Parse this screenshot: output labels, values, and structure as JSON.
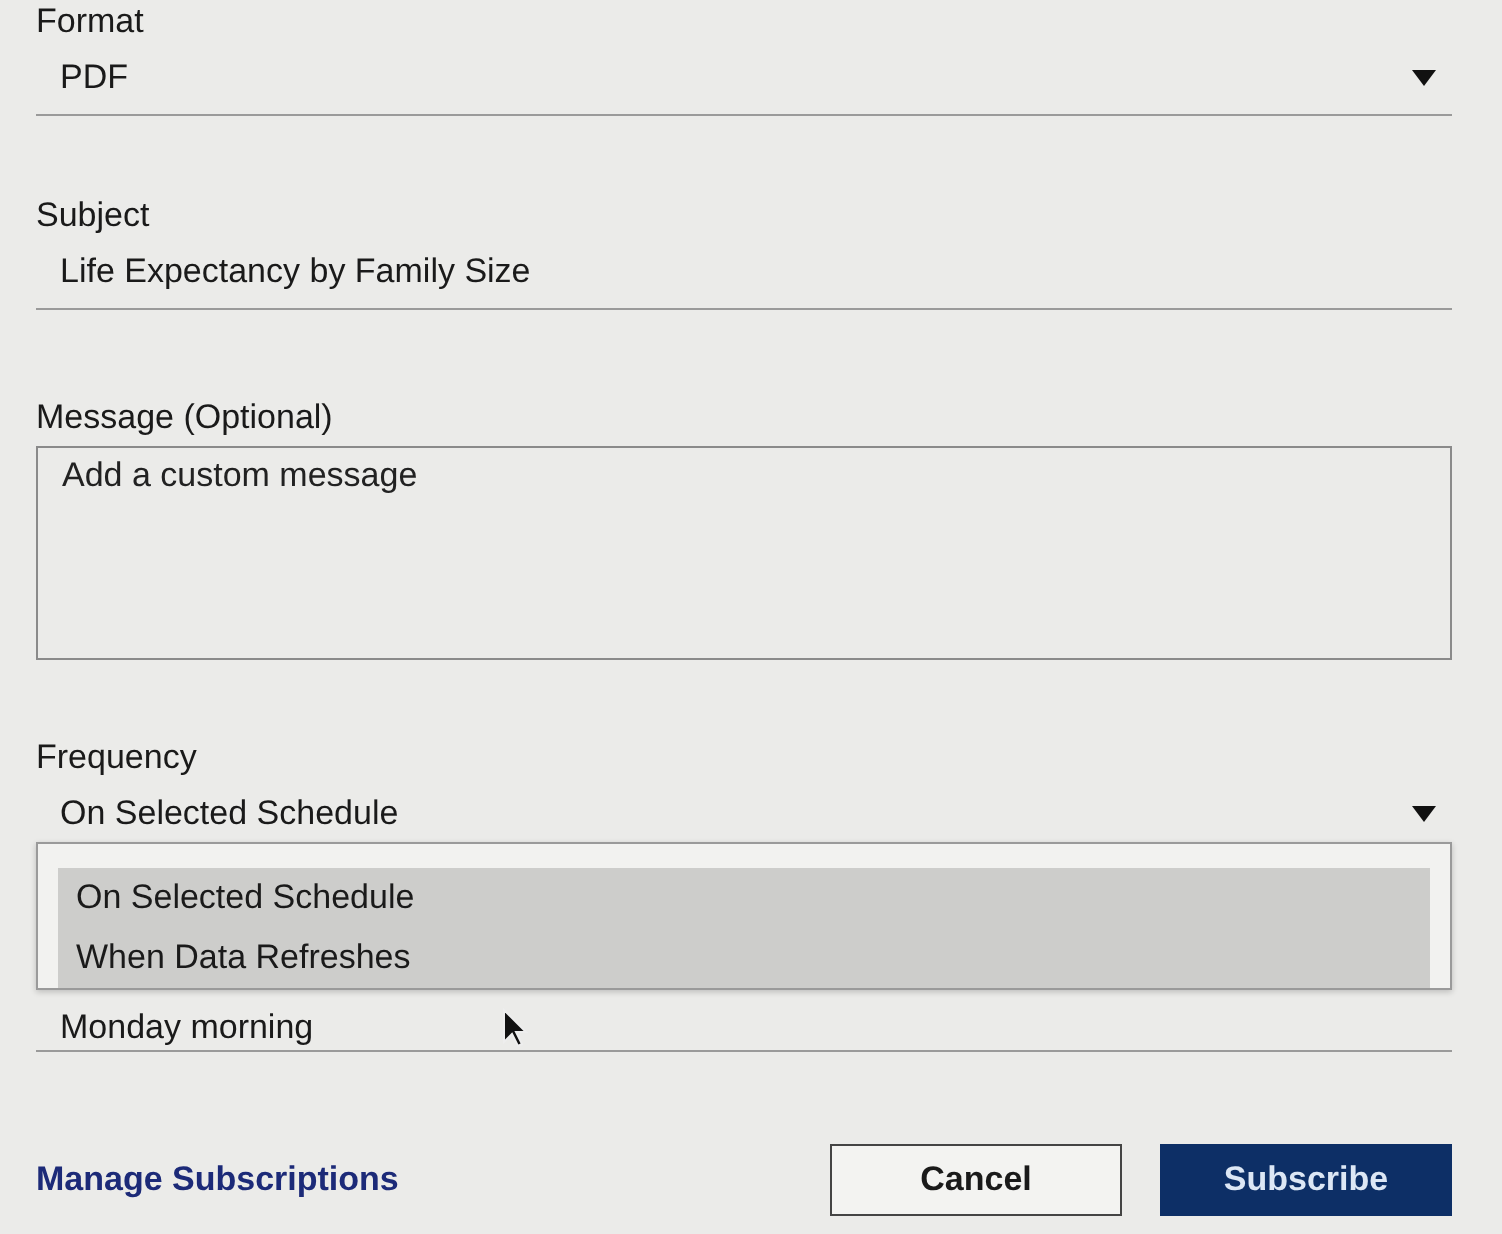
{
  "format": {
    "label": "Format",
    "value": "PDF"
  },
  "subject": {
    "label": "Subject",
    "value": "Life Expectancy by Family Size"
  },
  "message": {
    "label": "Message (Optional)",
    "placeholder": "Add a custom message"
  },
  "frequency": {
    "label": "Frequency",
    "value": "On Selected Schedule",
    "expanded": true,
    "options": [
      {
        "label": "On Selected Schedule"
      },
      {
        "label": "When Data Refreshes"
      }
    ]
  },
  "schedule": {
    "value": "Monday morning"
  },
  "manage_link": "Manage Subscriptions",
  "buttons": [
    {
      "label": "Cancel",
      "kind": "secondary"
    },
    {
      "label": "Subscribe",
      "kind": "primary"
    }
  ]
}
